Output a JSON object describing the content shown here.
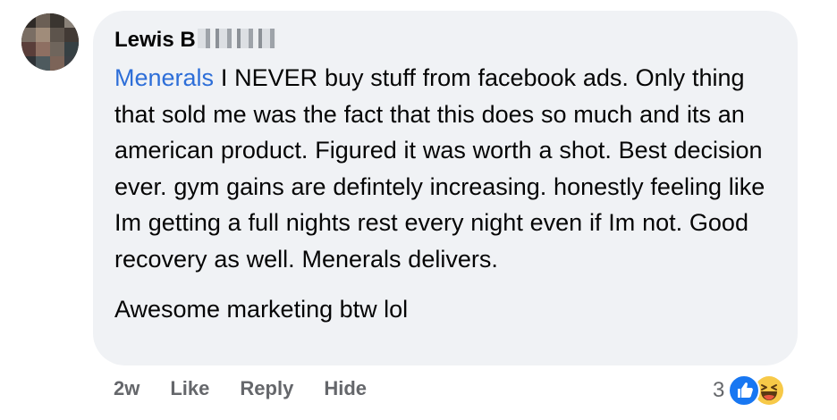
{
  "comment": {
    "author": "Lewis B",
    "mention": "Menerals",
    "text_paragraph_1": " I NEVER buy stuff from facebook ads. Only thing that sold me was the fact that this does so much and its an american product. Figured it was worth a shot. Best decision ever. gym gains are defintely increasing. honestly feeling like Im getting a full nights rest every night even if Im not. Good recovery as well. Menerals delivers.",
    "text_paragraph_2": "Awesome marketing btw lol"
  },
  "actions": {
    "timestamp": "2w",
    "like_label": "Like",
    "reply_label": "Reply",
    "hide_label": "Hide"
  },
  "reactions": {
    "count": "3",
    "icons": [
      "like-icon",
      "haha-icon"
    ]
  },
  "colors": {
    "bubble_bg": "#f0f2f5",
    "mention": "#2d6ed8",
    "action_text": "#65676b",
    "like_blue": "#1877f2",
    "haha_yellow": "#f7c948"
  }
}
